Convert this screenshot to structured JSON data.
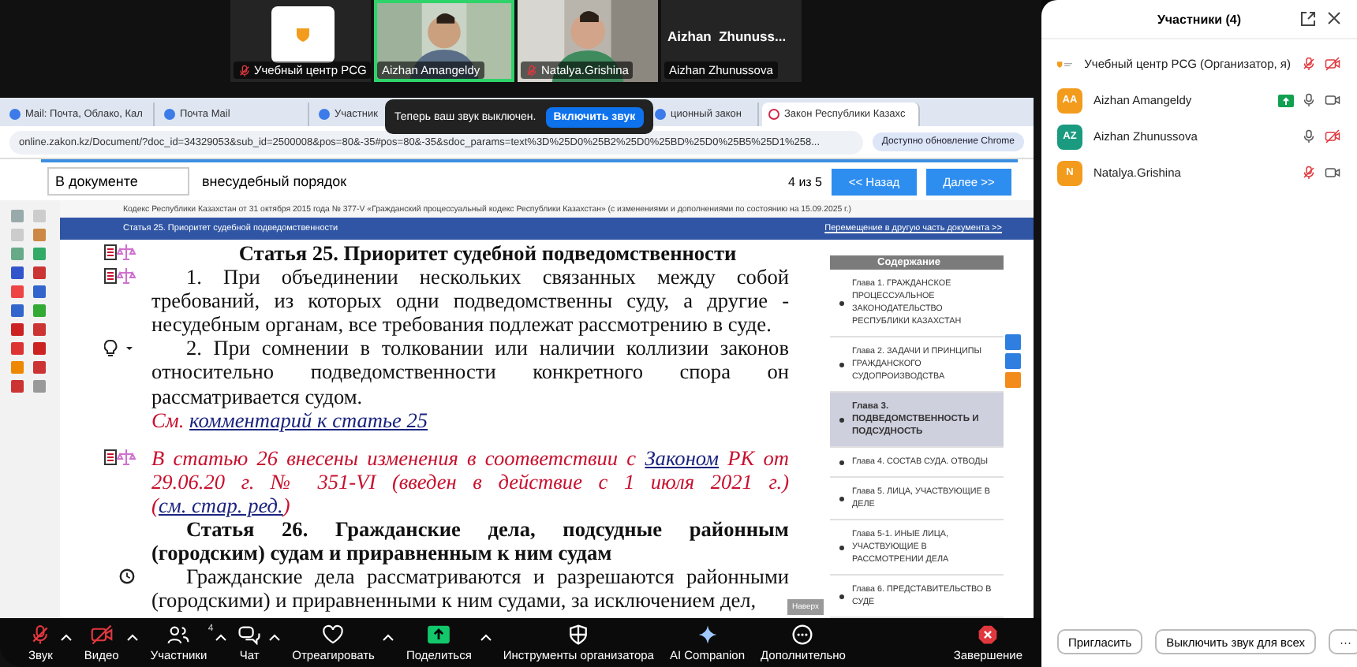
{
  "videos": [
    {
      "kind": "logo",
      "label": "Учебный центр PCG",
      "muted": true,
      "speaking": false
    },
    {
      "kind": "camera",
      "label": "Aizhan Amangeldy",
      "muted": false,
      "speaking": true
    },
    {
      "kind": "camera",
      "label": "Natalya.Grishina",
      "muted": true,
      "speaking": false
    },
    {
      "kind": "name",
      "display": "Aizhan  Zhunuss...",
      "label": "Aizhan Zhunussova",
      "muted": false,
      "speaking": false
    }
  ],
  "toast": {
    "text": "Теперь ваш звук выключен.",
    "button": "Включить звук"
  },
  "browser": {
    "tabs": [
      {
        "title": "Mail: Почта, Облако, Кал",
        "selected": false
      },
      {
        "title": "Почта Mail",
        "selected": false
      },
      {
        "title": "Участник",
        "selected": false
      },
      {
        "title": "ционный закон",
        "selected": false
      },
      {
        "title": "Закон Республики Казахс",
        "selected": true
      }
    ],
    "address": "online.zakon.kz/Document/?doc_id=34329053&sub_id=2500008&pos=80&-35#pos=80&-35&sdoc_params=text%3D%25D0%25B2%25D0%25BD%25D0%25B5%25D1%258...",
    "update_button": "Доступно обновление Chrome"
  },
  "find_bar": {
    "scope": "В документе",
    "value": "внесудебный порядок",
    "count": "4 из 5",
    "prev": "<< Назад",
    "next": "Далее >>"
  },
  "document": {
    "caption": "Кодекс Республики Казахстан от 31 октября 2015 года № 377-V «Гражданский процессуальный кодекс Республики Казахстан» (с изменениями и дополнениями по состоянию на 15.09.2025 г.)",
    "section_title": "Статья 25. Приоритет судебной подведомственности",
    "move_link": "Перемещение в другую часть документа >>",
    "blocks": [
      {
        "kind": "heading",
        "marker": {
          "kind": "doc"
        },
        "segments": [
          {
            "text": "Статья 25. Приоритет судебной подведомственности"
          }
        ]
      },
      {
        "kind": "para",
        "marker": {
          "kind": "doc"
        },
        "segments": [
          {
            "text": "1. При объединении нескольких связанных между собой требований, из которых одни подведомственны суду, а другие - несудебным органам, все требования подлежат рассмотрению в суде."
          }
        ]
      },
      {
        "kind": "para",
        "marker": {
          "kind": "bulb"
        },
        "segments": [
          {
            "text": "2. При сомнении в толковании или наличии коллизии законов относительно подведомственности конкретного спора он рассматривается судом."
          }
        ]
      },
      {
        "kind": "see",
        "segments": [
          {
            "text": "См. "
          },
          {
            "text": "комментарий к статье 25",
            "link": true
          }
        ]
      },
      {
        "kind": "note",
        "marker": {
          "kind": "doc"
        },
        "segments": [
          {
            "text": "В статью 26 внесены изменения в соответствии с "
          },
          {
            "text": "Законом",
            "link": true
          },
          {
            "text": " РК от 29.06.20 г. № 351-VI (введен в действие с 1 июля 2021 г.) ("
          },
          {
            "text": "см. стар. ред.",
            "link": true
          },
          {
            "text": ")"
          }
        ]
      },
      {
        "kind": "heading",
        "segments": [
          {
            "text": "Статья 26. Гражданские дела, подсудные районным (городским) судам и приравненным к ним судам"
          }
        ]
      },
      {
        "kind": "para",
        "marker": {
          "kind": "history"
        },
        "segments": [
          {
            "text": "Гражданские дела рассматриваются и разрешаются районными (городскими) и приравненными к ним судами, за исключением дел,"
          }
        ]
      }
    ],
    "toc": {
      "title": "Содержание",
      "items": [
        {
          "label": "Глава 1. ГРАЖДАНСКОЕ ПРОЦЕССУАЛЬНОЕ ЗАКОНОДАТЕЛЬСТВО РЕСПУБЛИКИ КАЗАХСТАН",
          "selected": false
        },
        {
          "label": "Глава 2. ЗАДАЧИ И ПРИНЦИПЫ ГРАЖДАНСКОГО СУДОПРОИЗВОДСТВА",
          "selected": false
        },
        {
          "label": "Глава 3. ПОДВЕДОМСТВЕННОСТЬ И ПОДСУДНОСТЬ",
          "selected": true
        },
        {
          "label": "Глава 4. СОСТАВ СУДА. ОТВОДЫ",
          "selected": false
        },
        {
          "label": "Глава 5. ЛИЦА, УЧАСТВУЮЩИЕ В ДЕЛЕ",
          "selected": false
        },
        {
          "label": "Глава 5-1. ИНЫЕ ЛИЦА, УЧАСТВУЮЩИЕ В РАССМОТРЕНИИ ДЕЛА",
          "selected": false
        },
        {
          "label": "Глава 6. ПРЕДСТАВИТЕЛЬСТВО В СУДЕ",
          "selected": false
        }
      ]
    },
    "scroll_top": "Наверх"
  },
  "toolbar": [
    {
      "kind": "mic",
      "label": "Звук",
      "off": true,
      "caret": true
    },
    {
      "kind": "video",
      "label": "Видео",
      "off": true,
      "caret": true
    },
    {
      "kind": "people",
      "label": "Участники",
      "badge": "4",
      "caret": true
    },
    {
      "kind": "chat",
      "label": "Чат",
      "caret": true
    },
    {
      "kind": "heart",
      "label": "Отреагировать",
      "caret": true
    },
    {
      "kind": "share",
      "label": "Поделиться",
      "caret": true
    },
    {
      "kind": "shield",
      "label": "Инструменты организатора"
    },
    {
      "kind": "sparkle",
      "label": "AI Companion"
    },
    {
      "kind": "more",
      "label": "Дополнительно"
    },
    {
      "kind": "end",
      "label": "Завершение"
    }
  ],
  "participants_panel": {
    "title": "Участники (4)",
    "participants": [
      {
        "avatar": {
          "kind": "logo"
        },
        "name": "Учебный центр PCG (Организатор, я)",
        "sharing": false,
        "mic_muted": true,
        "camera_off": true
      },
      {
        "avatar": {
          "kind": "initials",
          "initials": "AA",
          "color": "#f29b1d"
        },
        "name": "Aizhan Amangeldy",
        "sharing": true,
        "mic_muted": false,
        "camera_off": false
      },
      {
        "avatar": {
          "kind": "initials",
          "initials": "AZ",
          "color": "#1a9a7f"
        },
        "name": "Aizhan Zhunussova",
        "sharing": false,
        "mic_muted": false,
        "camera_off": true
      },
      {
        "avatar": {
          "kind": "initials",
          "initials": "N",
          "color": "#f29b1d"
        },
        "name": "Natalya.Grishina",
        "sharing": false,
        "mic_muted": true,
        "camera_off": false
      }
    ],
    "buttons": [
      "Пригласить",
      "Выключить звук для всех"
    ],
    "more": "···"
  }
}
